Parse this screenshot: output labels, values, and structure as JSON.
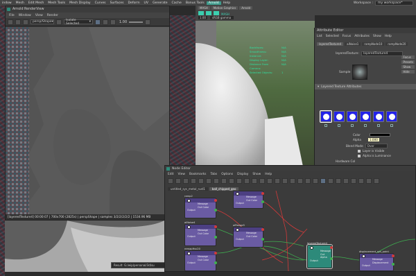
{
  "menubar": {
    "items": [
      "indow",
      "Mesh",
      "Edit Mesh",
      "Mesh Tools",
      "Mesh Display",
      "Curves",
      "Surfaces",
      "Deform",
      "UV",
      "Generate",
      "Cache",
      "Bonus Tools",
      "Arnold",
      "Help"
    ],
    "highlighted": "Arnold",
    "workspace_label": "Workspace :",
    "workspace_value": "my workspace*"
  },
  "render_view": {
    "title": "Arnold RenderView",
    "menus": [
      "File",
      "Window",
      "View",
      "Render"
    ],
    "camera": "persp/Shape",
    "isolate": "Isolate Selected",
    "zoom": "1.00",
    "status": "[layeredTexture4]  00:00:07 | 700x700 (2825s) | perspShape | samples 3/2/2/2/2/2 | 1534.96 MB"
  },
  "viewport": {
    "tabs": [
      "MASH",
      "Motion Graphics",
      "Arnold"
    ],
    "shelf_label": "MASH",
    "exposure": "1.00",
    "color_space": "sRGB gamma",
    "hud": [
      {
        "label": "Backfaces:",
        "value": "N/A"
      },
      {
        "label": "Smoothness:",
        "value": "N/A"
      },
      {
        "label": "Instance:",
        "value": "N/A"
      },
      {
        "label": "Display Layer:",
        "value": "N/A"
      },
      {
        "label": "Distance From Camera:",
        "value": "N/A"
      },
      {
        "label": "Selected Objects:",
        "value": "1"
      }
    ]
  },
  "attribute_editor": {
    "title": "Attribute Editor",
    "menus": [
      "List",
      "Selected",
      "Focus",
      "Attributes",
      "Show",
      "Help"
    ],
    "tabs": [
      "layeredTexture4",
      "aiNoise1",
      "rampNode10",
      "rampNode20"
    ],
    "node_label": "layeredTexture:",
    "node_value": "layeredTexture4",
    "focus_btn": "Focus",
    "presets_btn": "Presets",
    "show_btn": "Show",
    "hide_btn": "Hide",
    "sample_label": "Sample",
    "section": "Layered Texture Attributes",
    "color_label": "Color",
    "alpha_label": "Alpha",
    "alpha_value": "1.000",
    "blend_label": "Blend Mode",
    "blend_value": "Over",
    "layer_visible": "Layer is Visible",
    "alpha_lum": "Alpha is Luminance",
    "hardware_label": "Hardware Col"
  },
  "node_editor": {
    "title": "Node Editor",
    "menus": [
      "Edit",
      "View",
      "Bookmarks",
      "Tabs",
      "Options",
      "Display",
      "Show",
      "Help"
    ],
    "tabs": [
      "untitled_sys_metal_rust1",
      "ball_chipped_geo"
    ],
    "nodes": [
      {
        "name": "ramp2",
        "lines": [
          "Message",
          "Out Color"
        ]
      },
      {
        "name": "remapHsv16",
        "lines": [
          "Message",
          "Out Color"
        ]
      },
      {
        "name": "aiNoise4",
        "lines": [
          "Message",
          "Out Color"
        ]
      },
      {
        "name": "aiRange5",
        "lines": [
          "Message",
          "Out Color"
        ]
      },
      {
        "name": "remapHsv20",
        "lines": [
          "Message",
          "Out Color"
        ]
      },
      {
        "name": "layeredTexture4",
        "lines": [
          "Message",
          "Out Alpha"
        ]
      },
      {
        "name": "displacement_sys_paint",
        "lines": [
          "Message",
          "Displacement"
        ]
      }
    ],
    "ports": [
      "Output",
      "Output",
      "Output",
      "Output",
      "Output",
      "Output",
      "Output"
    ]
  },
  "bottom": {
    "path": "Result: G:/wip/personal/3d/su"
  },
  "colors": {
    "arnold_teal": "#3f9b8c",
    "node_purple": "#6a5ba3",
    "node_teal": "#2d8a7a",
    "swatch_blue": "#2323e8"
  }
}
